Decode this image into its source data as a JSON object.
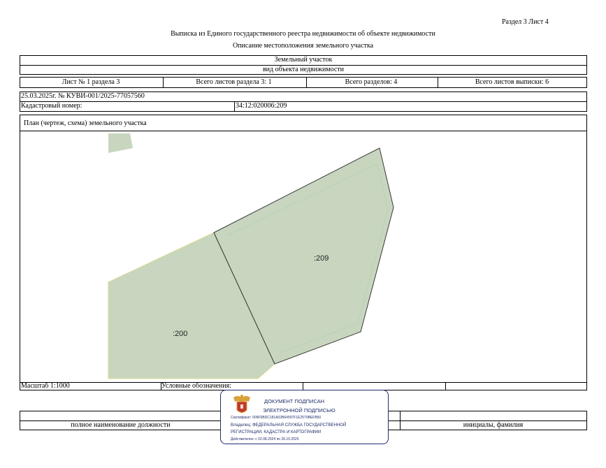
{
  "header": {
    "section_sheet": "Раздел 3   Лист 4",
    "title": "Выписка из Единого государственного реестра недвижимости об объекте недвижимости",
    "subtitle": "Описание местоположения земельного участка"
  },
  "object": {
    "type": "Земельный участок",
    "type_caption": "вид объекта недвижимости"
  },
  "sheet_info": {
    "sheet": "Лист № 1 раздела 3",
    "total_sheets_section": "Всего листов раздела 3: 1",
    "total_sections": "Всего разделов: 4",
    "total_sheets_extract": "Всего листов выписки: 6"
  },
  "document_ref": "25.03.2025г. № КУВИ-001/2025-77057560",
  "cadastral": {
    "label": "Кадастровый номер:",
    "value": "34:12:020006:209"
  },
  "plan": {
    "title": "План (чертеж, схема) земельного участка",
    "parcels": [
      {
        "label": ":209"
      },
      {
        "label": ":200"
      }
    ],
    "fill_color": "#c8d6bf",
    "stroke_color": "#3a3a3a"
  },
  "footer": {
    "scale": "Масштаб 1:1000",
    "legend": "Условные обозначения:",
    "position_caption": "полное наименование должности",
    "name_caption": "инициалы, фамилия"
  },
  "signature_stamp": {
    "line1": "ДОКУМЕНТ ПОДПИСАН",
    "line2": "ЭЛЕКТРОННОЙ ПОДПИСЬЮ",
    "certificate": "Сертификат: 009F0BDC181A02B64597F1E2579BEFB50",
    "owner_line1": "Владелец: ФЕДЕРАЛЬНАЯ СЛУЖБА ГОСУДАРСТВЕННОЙ",
    "owner_line2": "РЕГИСТРАЦИИ, КАДАСТРА И КАРТОГРАФИИ",
    "validity": "Действителен: с 02.08.2024 по 26.10.2025",
    "color": "#1f2d6b"
  }
}
